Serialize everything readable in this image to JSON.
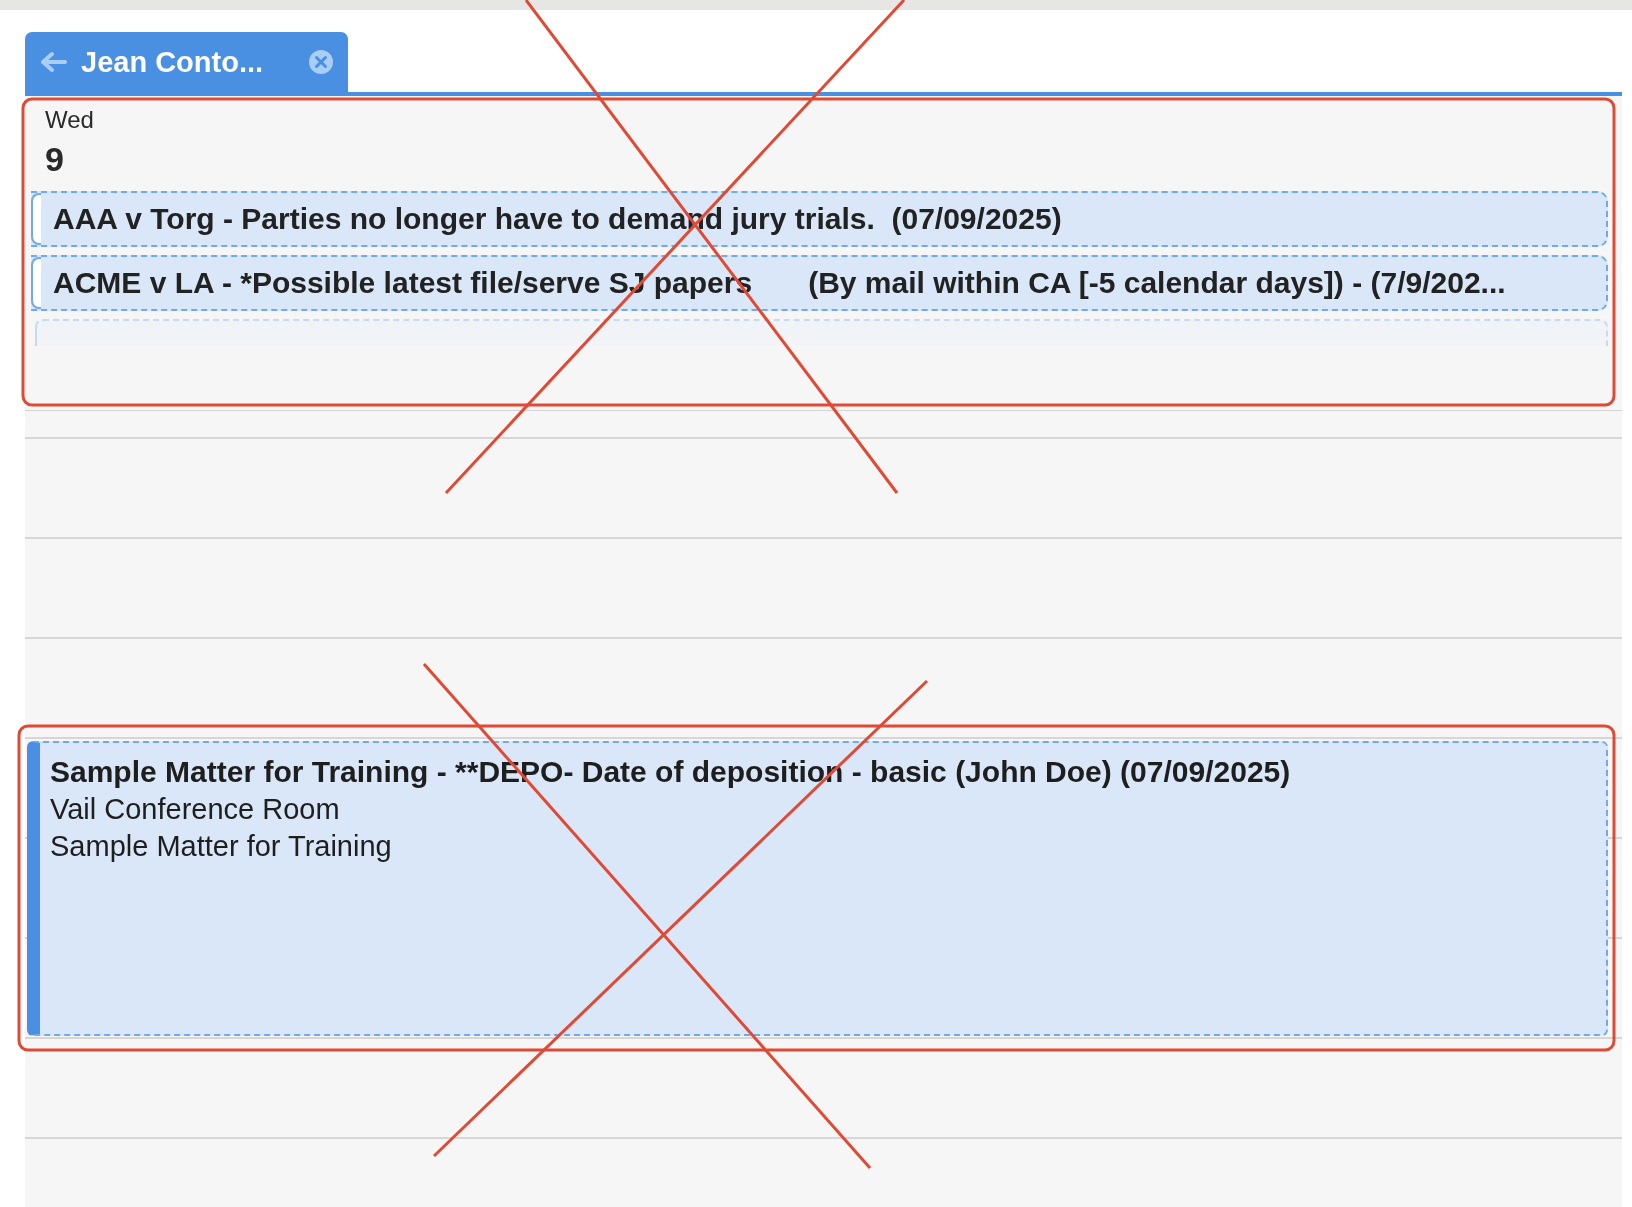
{
  "tab": {
    "label": "Jean Conto...",
    "selected": true
  },
  "day": {
    "weekday": "Wed",
    "date": "9"
  },
  "all_day_events": [
    {
      "parts": [
        "AAA v Torg - Parties no longer have to demand jury trials.  (07/09/2025)"
      ]
    },
    {
      "parts": [
        "ACME v LA - *Possible latest file/serve SJ papers",
        "(By mail within CA [-5 calendar days]) - (7/9/202..."
      ]
    }
  ],
  "timed_events": [
    {
      "title": "Sample Matter for Training - **DEPO- Date of deposition - basic (John Doe) (07/09/2025)",
      "lines": [
        "Vail Conference Room",
        "Sample Matter for Training"
      ]
    }
  ]
}
